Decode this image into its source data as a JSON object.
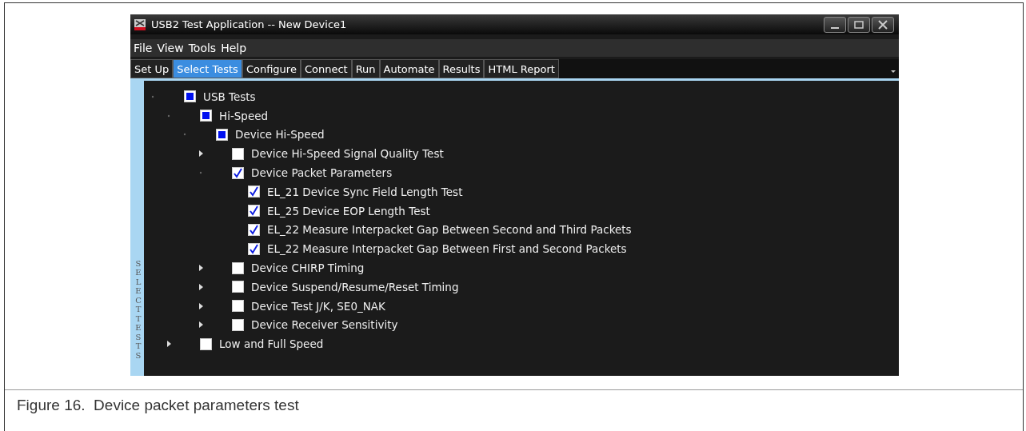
{
  "window": {
    "title": "USB2 Test Application -- New Device1"
  },
  "menu": [
    "File",
    "View",
    "Tools",
    "Help"
  ],
  "tabs": [
    {
      "label": "Set Up",
      "selected": false
    },
    {
      "label": "Select Tests",
      "selected": true
    },
    {
      "label": "Configure",
      "selected": false
    },
    {
      "label": "Connect",
      "selected": false
    },
    {
      "label": "Run",
      "selected": false
    },
    {
      "label": "Automate",
      "selected": false
    },
    {
      "label": "Results",
      "selected": false
    },
    {
      "label": "HTML Report",
      "selected": false
    }
  ],
  "side_label": "SELECT TESTS",
  "tree": [
    {
      "label": "USB Tests",
      "checked": false,
      "partial": true,
      "expanded": true,
      "children": [
        {
          "label": "Hi-Speed",
          "checked": false,
          "partial": true,
          "expanded": true,
          "children": [
            {
              "label": "Device Hi-Speed",
              "checked": false,
              "partial": true,
              "expanded": true,
              "children": [
                {
                  "label": "Device Hi-Speed Signal Quality Test",
                  "checked": false,
                  "partial": false,
                  "expanded": false
                },
                {
                  "label": "Device Packet Parameters",
                  "checked": true,
                  "partial": false,
                  "expanded": true,
                  "children": [
                    {
                      "label": "EL_21 Device Sync Field Length Test",
                      "checked": true,
                      "partial": false
                    },
                    {
                      "label": "EL_25 Device EOP Length Test",
                      "checked": true,
                      "partial": false
                    },
                    {
                      "label": "EL_22 Measure Interpacket Gap Between Second and Third Packets",
                      "checked": true,
                      "partial": false
                    },
                    {
                      "label": "EL_22 Measure Interpacket Gap Between First and Second Packets",
                      "checked": true,
                      "partial": false
                    }
                  ]
                },
                {
                  "label": "Device CHIRP Timing",
                  "checked": false,
                  "partial": false,
                  "expanded": false
                },
                {
                  "label": "Device Suspend/Resume/Reset Timing",
                  "checked": false,
                  "partial": false,
                  "expanded": false
                },
                {
                  "label": "Device Test J/K, SE0_NAK",
                  "checked": false,
                  "partial": false,
                  "expanded": false
                },
                {
                  "label": "Device Receiver Sensitivity",
                  "checked": false,
                  "partial": false,
                  "expanded": false
                }
              ]
            }
          ]
        },
        {
          "label": "Low and Full Speed",
          "checked": false,
          "partial": false,
          "expanded": false
        }
      ]
    }
  ],
  "caption": "Figure 16.  Device packet parameters test"
}
